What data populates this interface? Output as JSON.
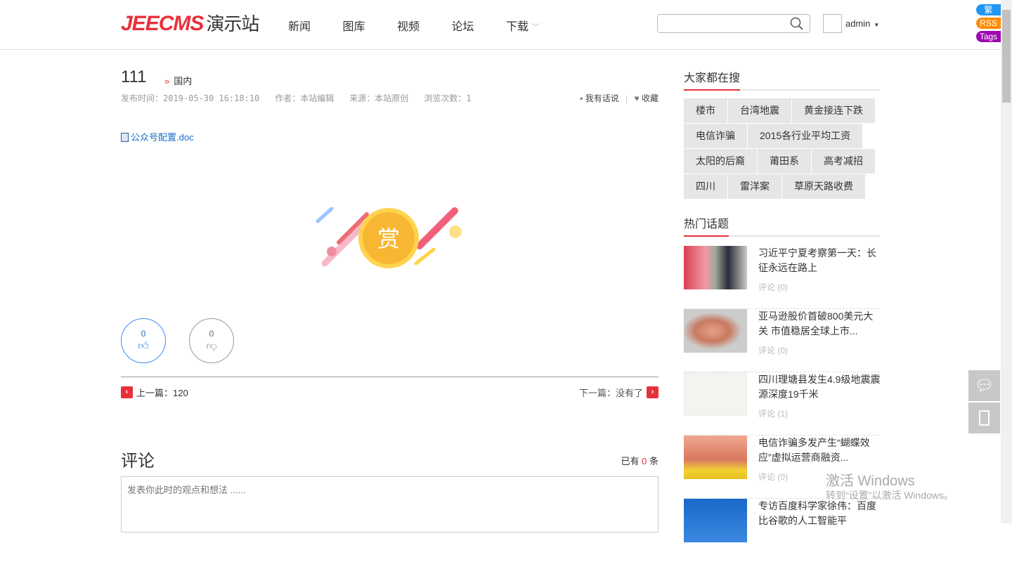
{
  "header": {
    "logo_brand": "JEECMS",
    "logo_suffix": "演示站",
    "nav": [
      "新闻",
      "图库",
      "视频",
      "论坛",
      "下载"
    ],
    "search_placeholder": "",
    "user": "admin"
  },
  "badges": [
    {
      "label": "繁",
      "color": "#2196f3"
    },
    {
      "label": "RSS",
      "color": "#ff8c00"
    },
    {
      "label": "Tags",
      "color": "#9c0aaf"
    }
  ],
  "article": {
    "title": "111",
    "category": "国内",
    "publish_time": "发布时间：2019-05-30 16:18:10",
    "author": "作者：本站编辑",
    "source": "来源：本站原创",
    "views": "浏览次数：1",
    "comment_action": "我有话说",
    "favorite_action": "收藏",
    "attachment": "公众号配置.doc",
    "reward_char": "赏",
    "likes": "0",
    "dislikes": "0",
    "prev": "上一篇：120",
    "next": "下一篇：没有了"
  },
  "comments": {
    "title": "评论",
    "count_prefix": "已有",
    "count": "0",
    "count_suffix": "条",
    "placeholder": "发表你此时的观点和想法 ......"
  },
  "sidebar": {
    "search_title": "大家都在搜",
    "tags": [
      "楼市",
      "台湾地震",
      "黄金接连下跌",
      "电信诈骗",
      "2015各行业平均工资",
      "太阳的后裔",
      "莆田系",
      "高考减招",
      "四川",
      "雷洋案",
      "草原天路收费"
    ],
    "hot_title": "热门话题",
    "hot": [
      {
        "title": "习近平宁夏考察第一天：长征永远在路上",
        "comments": "评论 (0)"
      },
      {
        "title": "亚马逊股价首破800美元大关 市值稳居全球上市...",
        "comments": "评论 (0)"
      },
      {
        "title": "四川理塘县发生4.9级地震震源深度19千米",
        "comments": "评论 (1)"
      },
      {
        "title": "电信诈骗多发产生“蝴蝶效应”虚拟运营商融资...",
        "comments": "评论 (0)"
      },
      {
        "title": "专访百度科学家徐伟：百度比谷歌的人工智能平",
        "comments": ""
      }
    ]
  },
  "watermark": {
    "line1": "激活 Windows",
    "line2": "转到“设置”以激活 Windows。"
  }
}
